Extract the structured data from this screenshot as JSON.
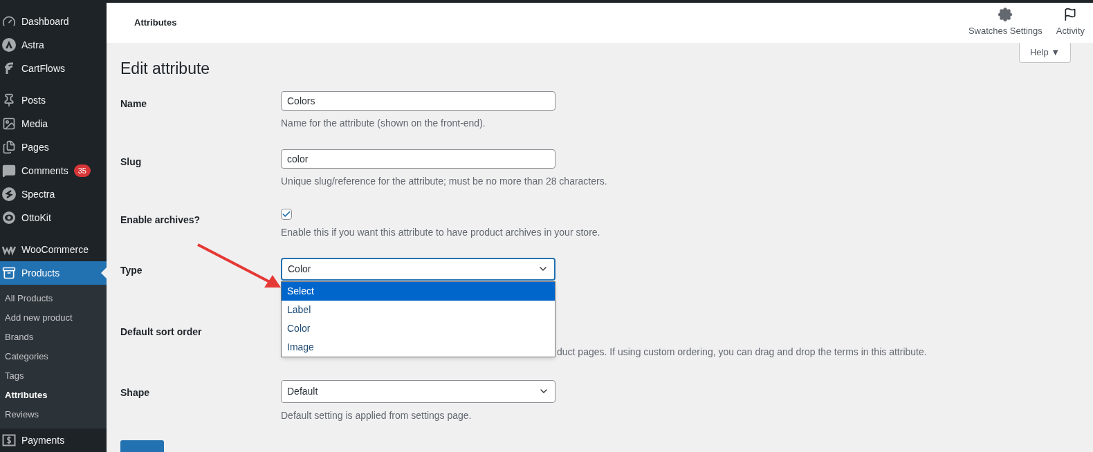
{
  "sidebar": {
    "groups": [
      {
        "items": [
          {
            "label": "Dashboard",
            "selected": false
          },
          {
            "label": "Astra",
            "selected": false
          },
          {
            "label": "CartFlows",
            "selected": false
          }
        ]
      },
      {
        "items": [
          {
            "label": "Posts",
            "selected": false
          },
          {
            "label": "Media",
            "selected": false
          },
          {
            "label": "Pages",
            "selected": false
          },
          {
            "label": "Comments",
            "selected": false,
            "badge": "35"
          },
          {
            "label": "Spectra",
            "selected": false
          },
          {
            "label": "OttoKit",
            "selected": false
          }
        ]
      },
      {
        "items": [
          {
            "label": "WooCommerce",
            "selected": false
          },
          {
            "label": "Products",
            "selected": true,
            "children": [
              {
                "label": "All Products",
                "selected": false
              },
              {
                "label": "Add new product",
                "selected": false
              },
              {
                "label": "Brands",
                "selected": false
              },
              {
                "label": "Categories",
                "selected": false
              },
              {
                "label": "Tags",
                "selected": false
              },
              {
                "label": "Attributes",
                "selected": true
              },
              {
                "label": "Reviews",
                "selected": false
              }
            ]
          },
          {
            "label": "Payments",
            "selected": false
          }
        ]
      }
    ]
  },
  "header": {
    "title": "Attributes",
    "actions": [
      {
        "label": "Swatches Settings"
      },
      {
        "label": "Activity"
      }
    ],
    "help": "Help ▼"
  },
  "page_title": "Edit attribute",
  "fields": [
    {
      "kind": "text",
      "label": "Name",
      "value": "Colors",
      "description": "Name for the attribute (shown on the front-end)."
    },
    {
      "kind": "text",
      "label": "Slug",
      "value": "color",
      "description": "Unique slug/reference for the attribute; must be no more than 28 characters."
    },
    {
      "kind": "checkbox",
      "label": "Enable archives?",
      "checked": true,
      "description": "Enable this if you want this attribute to have product archives in your store."
    },
    {
      "kind": "open_select",
      "label": "Type",
      "value": "Color",
      "options": [
        {
          "label": "Select",
          "highlighted": true
        },
        {
          "label": "Label",
          "highlighted": false
        },
        {
          "label": "Color",
          "highlighted": false
        },
        {
          "label": "Image",
          "highlighted": false
        }
      ]
    },
    {
      "kind": "covered",
      "label": "Default sort order",
      "description": "duct pages. If using custom ordering, you can drag and drop the terms in this attribute."
    },
    {
      "kind": "select",
      "label": "Shape",
      "value": "Default",
      "description": "Default setting is applied from settings page."
    }
  ]
}
